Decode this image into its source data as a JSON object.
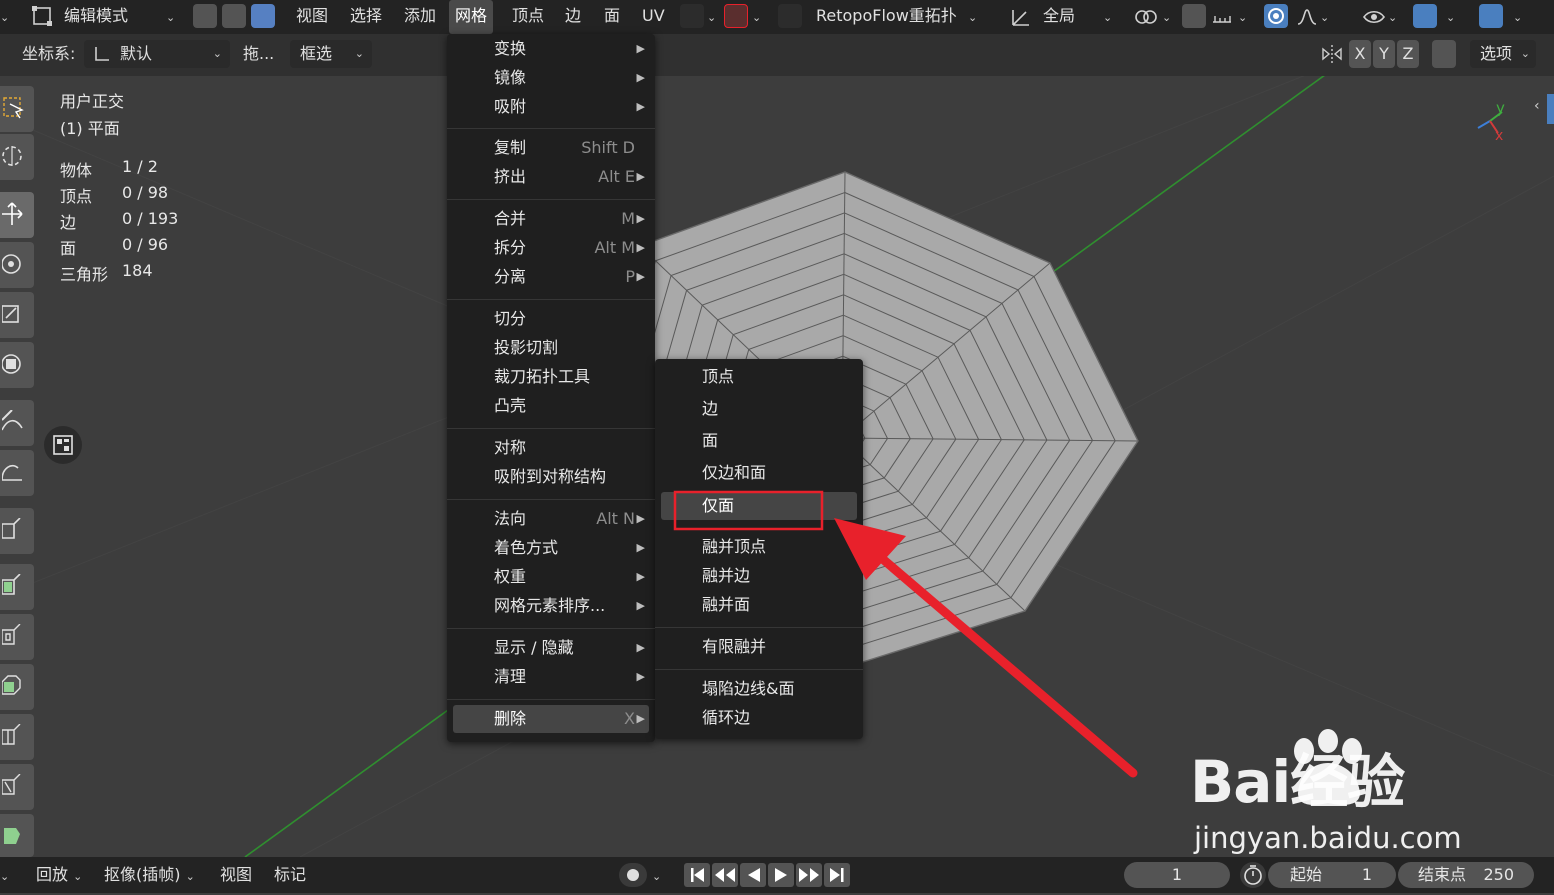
{
  "header": {
    "mode": "编辑模式",
    "menus": [
      "视图",
      "选择",
      "添加",
      "网格",
      "顶点",
      "边",
      "面",
      "UV"
    ],
    "active_menu": "网格",
    "addon": "RetopoFlow重拓扑",
    "transform_orientation": "全局"
  },
  "tool_header": {
    "coord_label": "坐标系:",
    "coord_value": "默认",
    "drag_label": "拖...",
    "select_mode": "框选",
    "axes": [
      "X",
      "Y",
      "Z"
    ],
    "options": "选项"
  },
  "viewport": {
    "view_name": "用户正交",
    "object_name": "(1) 平面",
    "stats": [
      {
        "label": "物体",
        "value": "1 / 2"
      },
      {
        "label": "顶点",
        "value": "0 / 98"
      },
      {
        "label": "边",
        "value": "0 / 193"
      },
      {
        "label": "面",
        "value": "0 / 96"
      },
      {
        "label": "三角形",
        "value": "184"
      }
    ],
    "gizmo": {
      "y": "y",
      "x": "x"
    },
    "colors": {
      "background": "#3d3d3d",
      "mesh": "#a9a9a9",
      "y_axis": "#2f8f2f",
      "arrow": "#e8212b",
      "highlight_box": "#e8212b"
    }
  },
  "mesh_menu": {
    "items": [
      {
        "label": "变换",
        "shortcut": "",
        "submenu": true
      },
      {
        "label": "镜像",
        "shortcut": "",
        "submenu": true
      },
      {
        "label": "吸附",
        "shortcut": "",
        "submenu": true
      },
      {
        "label": "复制",
        "shortcut": "Shift D",
        "submenu": false
      },
      {
        "label": "挤出",
        "shortcut": "Alt E",
        "submenu": true
      },
      {
        "label": "合并",
        "shortcut": "M",
        "submenu": true
      },
      {
        "label": "拆分",
        "shortcut": "Alt M",
        "submenu": true
      },
      {
        "label": "分离",
        "shortcut": "P",
        "submenu": true
      },
      {
        "label": "切分",
        "shortcut": "",
        "submenu": false
      },
      {
        "label": "投影切割",
        "shortcut": "",
        "submenu": false
      },
      {
        "label": "裁刀拓扑工具",
        "shortcut": "",
        "submenu": false
      },
      {
        "label": "凸壳",
        "shortcut": "",
        "submenu": false
      },
      {
        "label": "对称",
        "shortcut": "",
        "submenu": false
      },
      {
        "label": "吸附到对称结构",
        "shortcut": "",
        "submenu": false
      },
      {
        "label": "法向",
        "shortcut": "Alt N",
        "submenu": true
      },
      {
        "label": "着色方式",
        "shortcut": "",
        "submenu": true
      },
      {
        "label": "权重",
        "shortcut": "",
        "submenu": true
      },
      {
        "label": "网格元素排序...",
        "shortcut": "",
        "submenu": true
      },
      {
        "label": "显示 / 隐藏",
        "shortcut": "",
        "submenu": true
      },
      {
        "label": "清理",
        "shortcut": "",
        "submenu": true
      },
      {
        "label": "删除",
        "shortcut": "X",
        "submenu": true
      }
    ]
  },
  "delete_menu": {
    "items": [
      "顶点",
      "边",
      "面",
      "仅边和面",
      "仅面",
      "融并顶点",
      "融并边",
      "融并面",
      "有限融并",
      "塌陷边线&面",
      "循环边"
    ],
    "highlighted": "仅面"
  },
  "timeline": {
    "playback": "回放",
    "keying": "抠像(插帧)",
    "view": "视图",
    "marker": "标记",
    "current_frame": "1",
    "start_label": "起始",
    "start_value": "1",
    "end_label": "结束点",
    "end_value": "250"
  },
  "watermark": {
    "brand": "Bai经验",
    "url": "jingyan.baidu.com"
  }
}
